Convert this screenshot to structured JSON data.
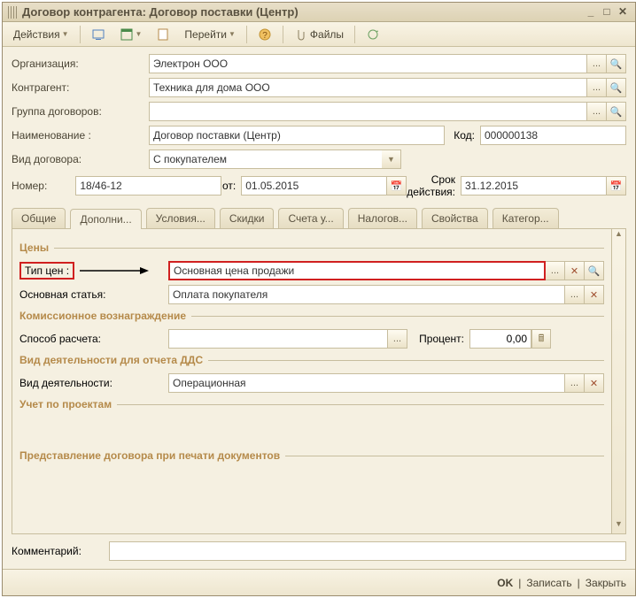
{
  "title": "Договор контрагента: Договор поставки (Центр)",
  "toolbar": {
    "actions": "Действия",
    "goto": "Перейти",
    "files": "Файлы"
  },
  "labels": {
    "org": "Организация:",
    "counterparty": "Контрагент:",
    "group": "Группа договоров:",
    "name": "Наименование :",
    "code": "Код:",
    "type": "Вид договора:",
    "number": "Номер:",
    "from": "от:",
    "validity": "Срок действия:",
    "comment": "Комментарий:"
  },
  "values": {
    "org": "Электрон ООО",
    "counterparty": "Техника для дома ООО",
    "group": "",
    "name": "Договор поставки (Центр)",
    "code": "000000138",
    "type": "С покупателем",
    "number": "18/46-12",
    "from": "01.05.2015",
    "validity": "31.12.2015",
    "comment": ""
  },
  "tabs": [
    "Общие",
    "Дополни...",
    "Условия...",
    "Скидки",
    "Счета у...",
    "Налогов...",
    "Свойства",
    "Категор..."
  ],
  "panel": {
    "prices_title": "Цены",
    "price_type_label": "Тип цен :",
    "price_type_value": "Основная цена продажи",
    "main_article_label": "Основная статья:",
    "main_article_value": "Оплата покупателя",
    "commission_title": "Комиссионное вознаграждение",
    "calc_method_label": "Способ расчета:",
    "calc_method_value": "",
    "percent_label": "Процент:",
    "percent_value": "0,00",
    "dds_title": "Вид деятельности для отчета ДДС",
    "activity_label": "Вид деятельности:",
    "activity_value": "Операционная",
    "projects_title": "Учет по проектам",
    "print_title": "Представление договора при печати документов"
  },
  "footer": {
    "ok": "OK",
    "save": "Записать",
    "close": "Закрыть"
  }
}
